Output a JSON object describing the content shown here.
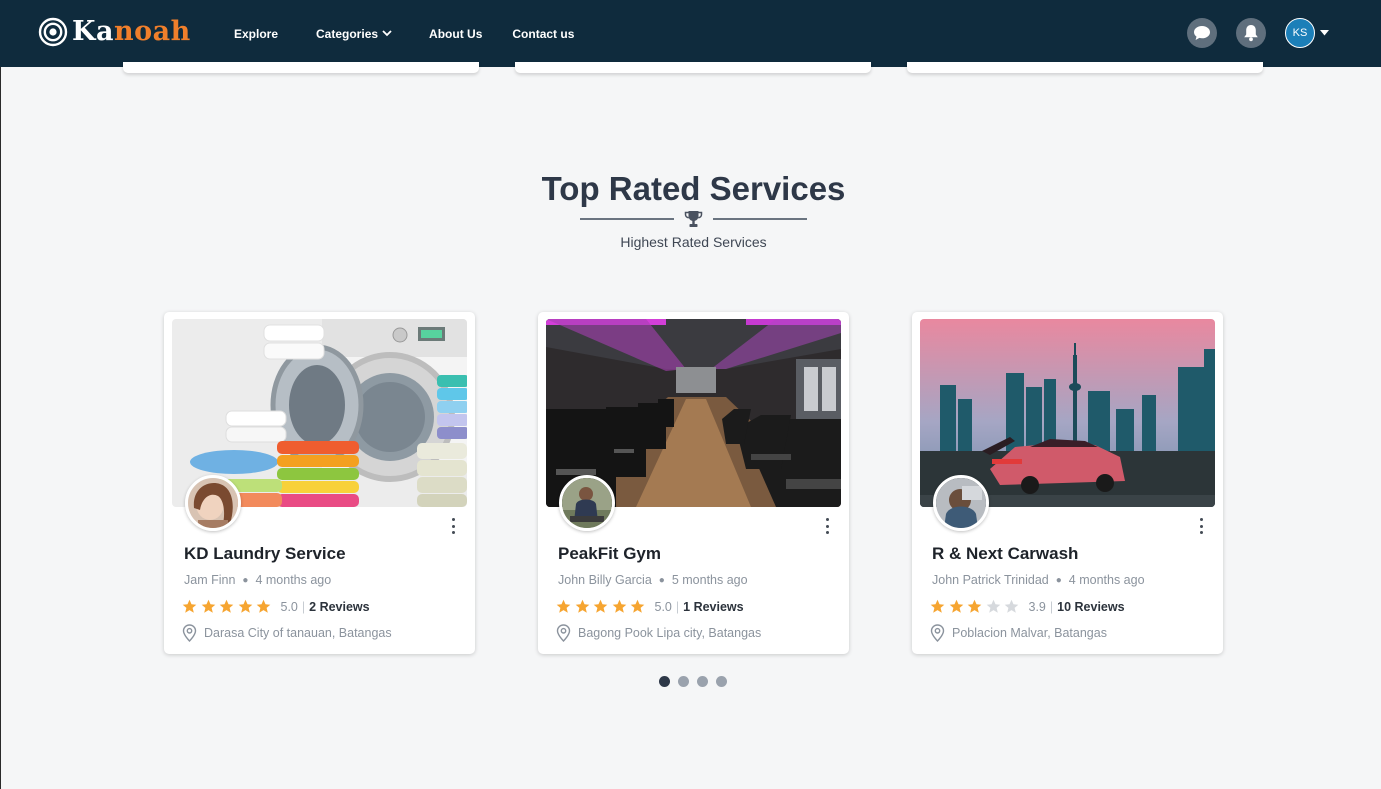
{
  "nav": {
    "logo": {
      "part1": "Ka",
      "part2": "noah"
    },
    "links": {
      "explore": "Explore",
      "categories": "Categories",
      "about": "About Us",
      "contact": "Contact us"
    },
    "icons": {
      "chat": "chat-icon",
      "bell": "bell-icon",
      "caret": "caret-down-icon"
    },
    "user_initials": "KS"
  },
  "section": {
    "title": "Top Rated Services",
    "subtitle": "Highest Rated Services",
    "icon": "trophy-icon"
  },
  "cards": [
    {
      "title": "KD Laundry Service",
      "owner": "Jam Finn",
      "time": "4 months ago",
      "rating": "5.0",
      "stars_filled": 5,
      "reviews": "2 Reviews",
      "location": "Darasa City of tanauan, Batangas",
      "image": "laundry-image"
    },
    {
      "title": "PeakFit Gym",
      "owner": "John Billy Garcia",
      "time": "5 months ago",
      "rating": "5.0",
      "stars_filled": 5,
      "reviews": "1 Reviews",
      "location": "Bagong Pook Lipa city, Batangas",
      "image": "gym-image"
    },
    {
      "title": "R & Next Carwash",
      "owner": "John Patrick Trinidad",
      "time": "4 months ago",
      "rating": "3.9",
      "stars_filled": 3,
      "reviews": "10 Reviews",
      "location": "Poblacion Malvar, Batangas",
      "image": "carwash-image"
    }
  ],
  "pagination": {
    "pages": 4,
    "active": 0
  },
  "colors": {
    "navbar": "#0f2b3d",
    "logo_accent": "#f07f2b",
    "star": "#f6a531",
    "star_empty": "#d6d9dd",
    "avatar": "#1c7fb8"
  }
}
